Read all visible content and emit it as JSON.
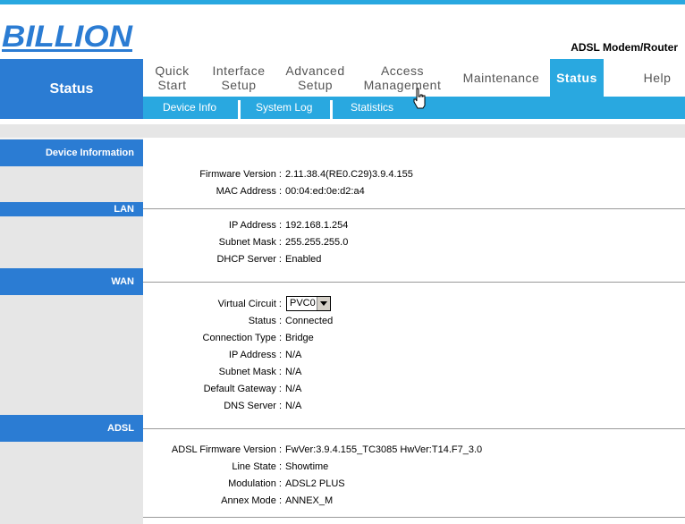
{
  "header": {
    "logo_text": "BILLION",
    "product": "ADSL Modem/Router",
    "section_title": "Status"
  },
  "menu": [
    {
      "label": "Quick Start"
    },
    {
      "label": "Interface Setup"
    },
    {
      "label": "Advanced Setup"
    },
    {
      "label": "Access Management"
    },
    {
      "label": "Maintenance"
    },
    {
      "label": "Status",
      "active": true
    },
    {
      "label": "Help"
    }
  ],
  "submenu": [
    "Device Info",
    "System Log",
    "Statistics"
  ],
  "sections": {
    "device": {
      "title": "Device Information",
      "firmware_label": "Firmware Version :",
      "firmware": "2.11.38.4(RE0.C29)3.9.4.155",
      "mac_label": "MAC Address :",
      "mac": "00:04:ed:0e:d2:a4"
    },
    "lan": {
      "title": "LAN",
      "ip_label": "IP Address :",
      "ip": "192.168.1.254",
      "mask_label": "Subnet Mask :",
      "mask": "255.255.255.0",
      "dhcp_label": "DHCP Server :",
      "dhcp": "Enabled"
    },
    "wan": {
      "title": "WAN",
      "vc_label": "Virtual Circuit :",
      "vc": "PVC0",
      "status_label": "Status :",
      "status": "Connected",
      "conn_label": "Connection Type :",
      "conn": "Bridge",
      "ip_label": "IP Address :",
      "ip": "N/A",
      "mask_label": "Subnet Mask :",
      "mask": "N/A",
      "gw_label": "Default Gateway :",
      "gw": "N/A",
      "dns_label": "DNS Server :",
      "dns": "N/A"
    },
    "adsl": {
      "title": "ADSL",
      "fw_label": "ADSL Firmware Version :",
      "fw": "FwVer:3.9.4.155_TC3085 HwVer:T14.F7_3.0",
      "line_label": "Line State :",
      "line": "Showtime",
      "mod_label": "Modulation :",
      "mod": "ADSL2 PLUS",
      "annex_label": "Annex Mode :",
      "annex": "ANNEX_M"
    }
  },
  "colors": {
    "accent_blue": "#2b7cd3",
    "light_blue": "#29a8e0",
    "gray": "#e6e6e6"
  }
}
